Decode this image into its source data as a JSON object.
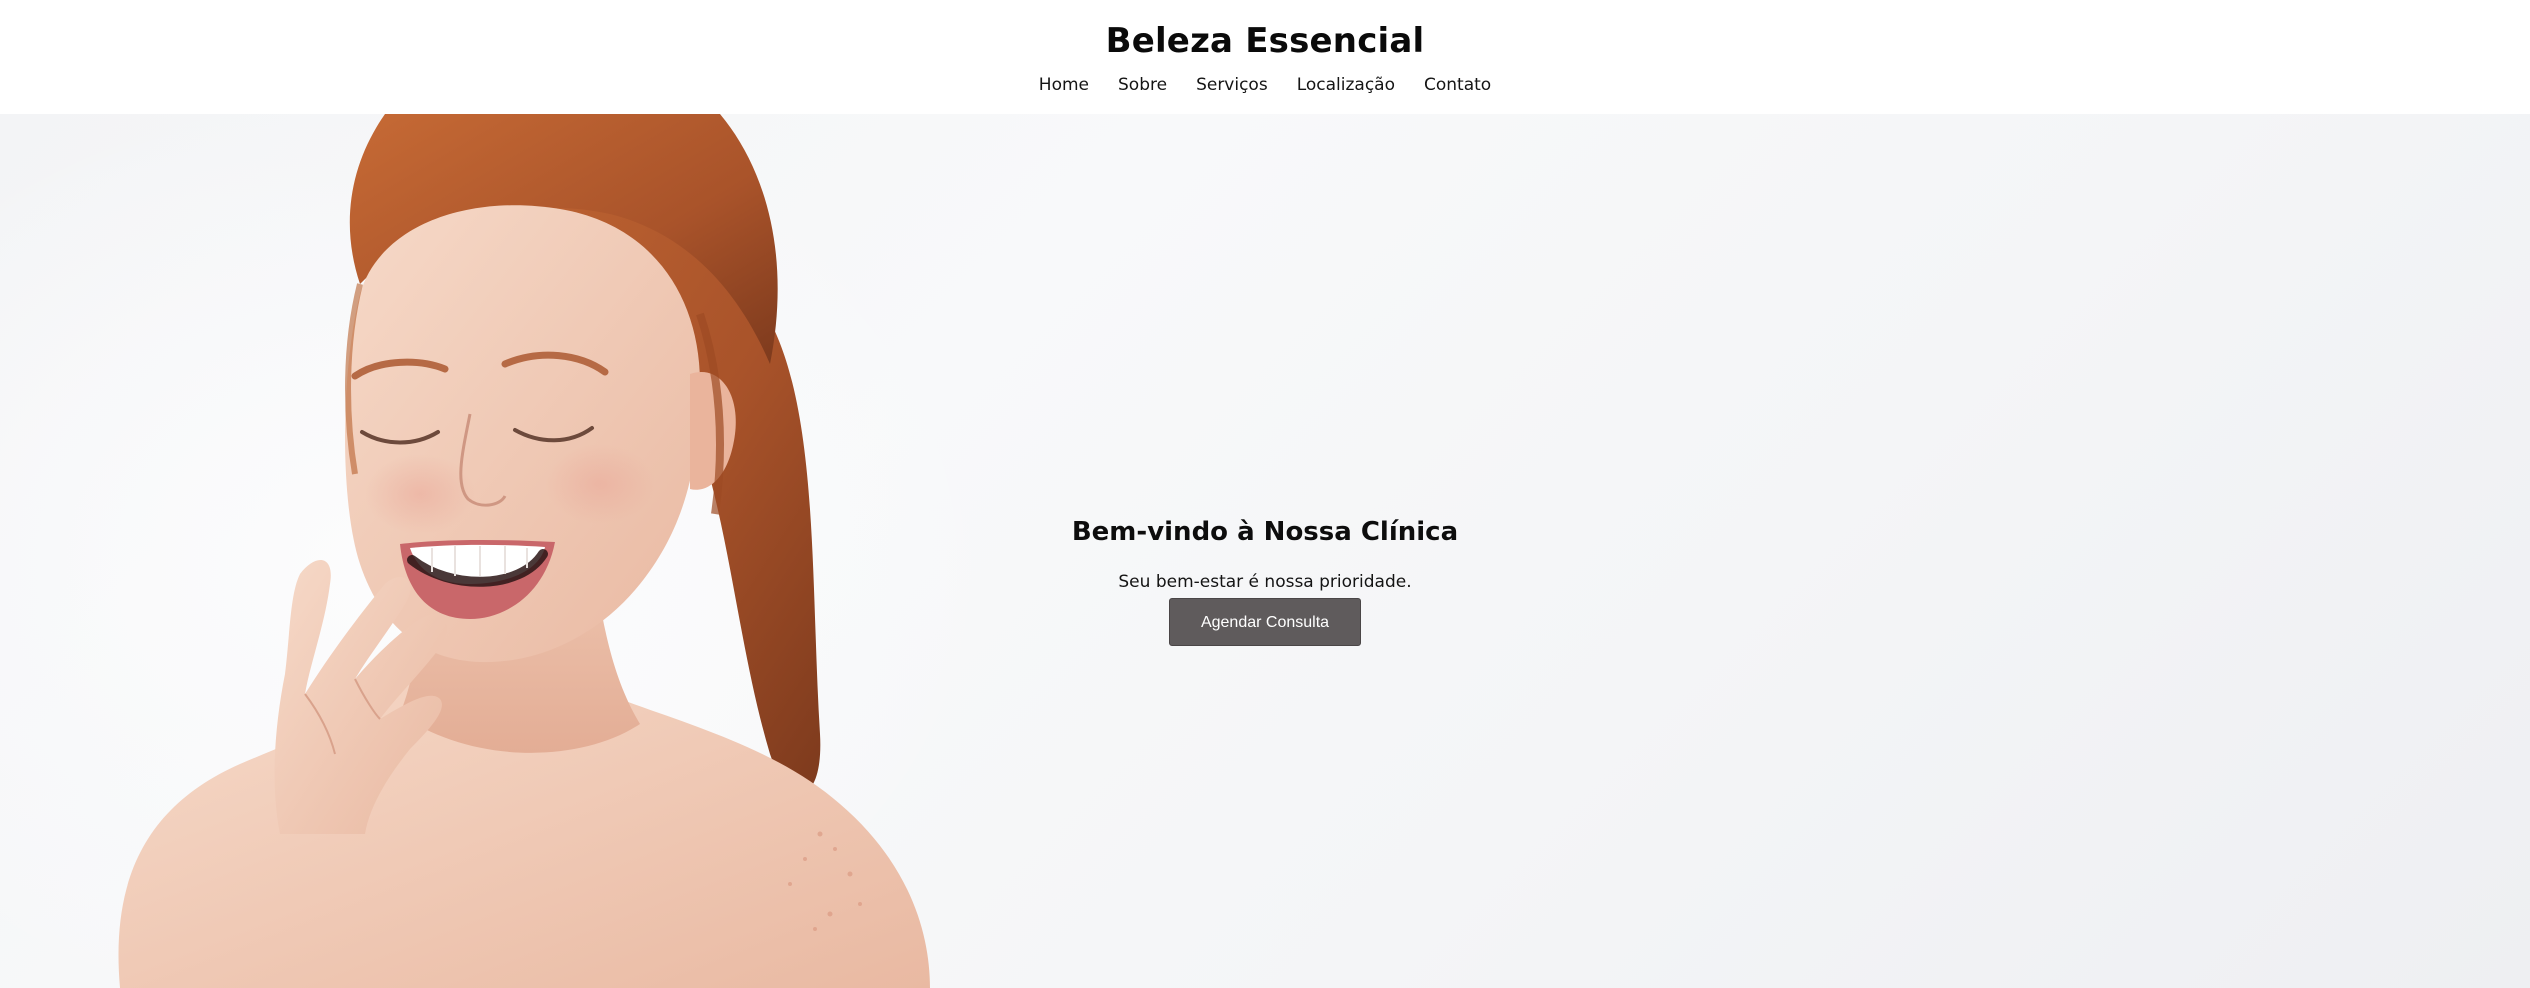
{
  "header": {
    "brand": "Beleza Essencial",
    "nav": [
      {
        "label": "Home"
      },
      {
        "label": "Sobre"
      },
      {
        "label": "Serviços"
      },
      {
        "label": "Localização"
      },
      {
        "label": "Contato"
      }
    ]
  },
  "hero": {
    "heading": "Bem-vindo à Nossa Clínica",
    "subtitle": "Seu bem-estar é nossa prioridade.",
    "cta_label": "Agendar Consulta",
    "image_alt": "smiling woman with red hair, bare shoulders, hand near chin"
  },
  "colors": {
    "page_background": "#ffffff",
    "hero_background": "#f4f5f7",
    "cta_background": "#5f5b5c",
    "text_primary": "#111111"
  }
}
